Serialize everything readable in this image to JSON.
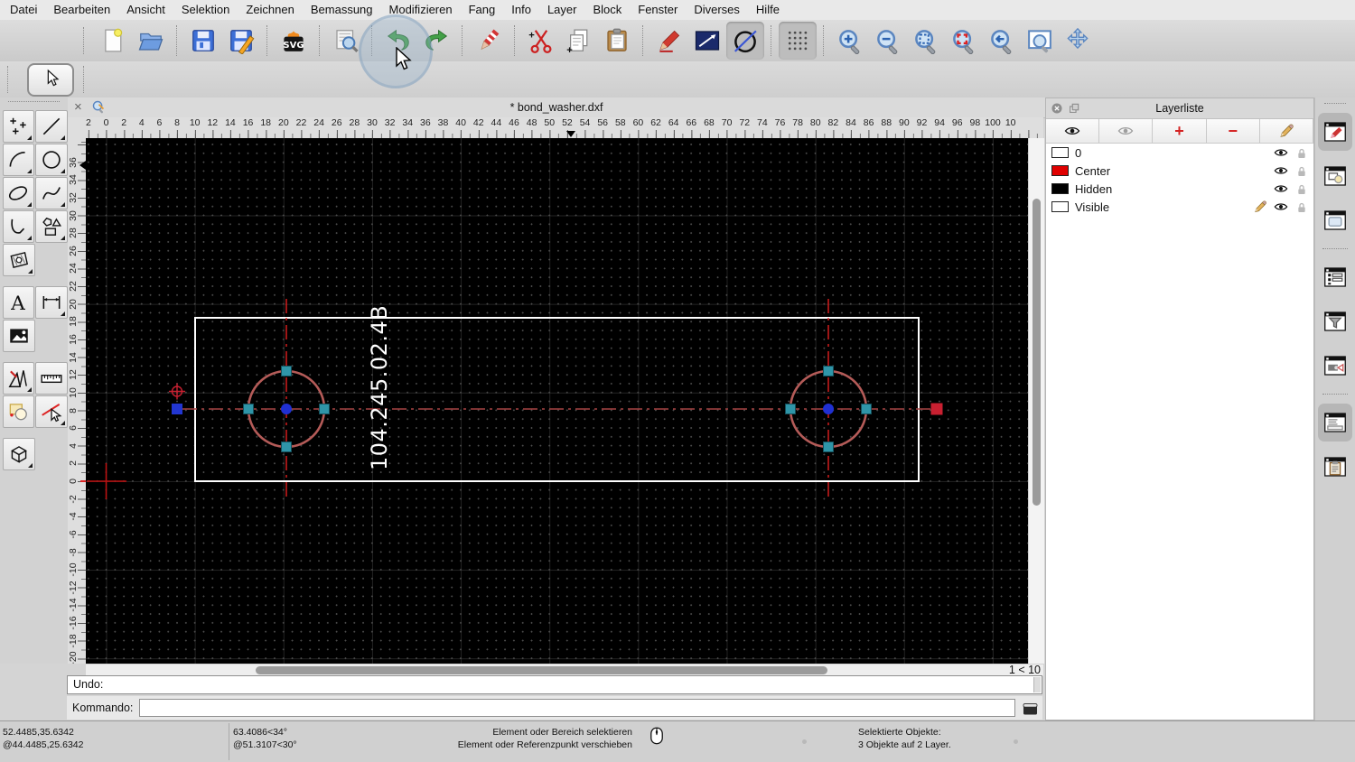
{
  "menu_bar": {
    "items": [
      "Datei",
      "Bearbeiten",
      "Ansicht",
      "Selektion",
      "Zeichnen",
      "Bemassung",
      "Modifizieren",
      "Fang",
      "Info",
      "Layer",
      "Block",
      "Fenster",
      "Diverses",
      "Hilfe"
    ]
  },
  "main_toolbar": {
    "groups": [
      [
        "file-new",
        "folder-open"
      ],
      [
        "save",
        "save-as"
      ],
      [
        "svg-export"
      ],
      [
        "print-preview"
      ],
      [
        "undo",
        "redo"
      ],
      [
        "delete-selection"
      ],
      [
        "cut",
        "copy",
        "paste"
      ],
      [
        "pen",
        "line-attributes",
        "draft-mode"
      ],
      [
        "grid-toggle"
      ],
      [
        "zoom-in",
        "zoom-out",
        "zoom-auto",
        "zoom-selected",
        "zoom-previous",
        "zoom-window",
        "zoom-pan"
      ]
    ],
    "pressed": [
      "draft-mode",
      "grid-toggle"
    ]
  },
  "select_toolbar": {
    "tool": "select-arrow"
  },
  "tool_palette": {
    "rows": [
      [
        "points",
        "line"
      ],
      [
        "arc",
        "circle"
      ],
      [
        "ellipse",
        "spline"
      ],
      [
        "polyline",
        "polygon"
      ],
      [
        "hatch"
      ],
      [
        "GAP"
      ],
      [
        "text",
        "dimension"
      ],
      [
        "image"
      ],
      [
        "GAP"
      ],
      [
        "modify",
        "measure"
      ],
      [
        "order",
        "attributes"
      ],
      [
        "GAP"
      ],
      [
        "solid"
      ]
    ],
    "with_submenu": [
      "points",
      "line",
      "arc",
      "circle",
      "ellipse",
      "spline",
      "polyline",
      "polygon",
      "hatch",
      "dimension",
      "modify",
      "attributes",
      "solid"
    ]
  },
  "document_tab": {
    "title": "* bond_washer.dxf"
  },
  "rulers": {
    "horizontal_labels": [
      "2",
      "0",
      "2",
      "4",
      "6",
      "8",
      "10",
      "12",
      "14",
      "16",
      "18",
      "20",
      "22",
      "24",
      "26",
      "28",
      "30",
      "32",
      "34",
      "36",
      "38",
      "40",
      "42",
      "44",
      "46",
      "48",
      "50",
      "52",
      "54",
      "56",
      "58",
      "60",
      "62",
      "64",
      "66",
      "68",
      "70",
      "72",
      "74",
      "76",
      "78",
      "80",
      "82",
      "84",
      "86",
      "88",
      "90",
      "92",
      "94",
      "96",
      "98",
      "100",
      "10"
    ],
    "vertical_labels": [
      "36",
      "34",
      "32",
      "30",
      "28",
      "26",
      "24",
      "22",
      "20",
      "18",
      "16",
      "14",
      "12",
      "10",
      "8",
      "6",
      "4",
      "2",
      "0",
      "-2",
      "-4",
      "-6",
      "-8",
      "-10",
      "-12",
      "-14",
      "-16",
      "-18",
      "-20"
    ]
  },
  "canvas": {
    "part_label": "104.245.02.4B",
    "colors": {
      "background": "#000000",
      "outline": "#ffffff",
      "hole_circle": "#b45b58",
      "centerline_vertical": "#e02020",
      "centerline_horizontal": "#a84444",
      "selection_handle": "#2f95a8",
      "center_node": "#2030d2",
      "endpoint_blue": "#2236d1",
      "endpoint_red": "#c92031",
      "origin_cross": "#c01010"
    }
  },
  "scrollbars": {
    "zoom_indicator": "1 < 10"
  },
  "layer_panel": {
    "title": "Layerliste",
    "toolbar": [
      "show-all-layers",
      "hide-all-layers",
      "add-layer",
      "remove-layer",
      "edit-layer"
    ],
    "layers": [
      {
        "name": "0",
        "color": "#ffffff",
        "editing": false,
        "visible": true,
        "locked": false
      },
      {
        "name": "Center",
        "color": "#e00000",
        "editing": false,
        "visible": true,
        "locked": false
      },
      {
        "name": "Hidden",
        "color": "#000000",
        "editing": false,
        "visible": true,
        "locked": false
      },
      {
        "name": "Visible",
        "color": "#ffffff",
        "editing": true,
        "visible": true,
        "locked": false
      }
    ]
  },
  "dock_strip": {
    "items": [
      "dock-pen-panel",
      "dock-block-panel",
      "dock-preview-panel",
      "dock-list-panel",
      "dock-filter-panel",
      "dock-beamer-panel",
      "dock-command-panel",
      "dock-clipboard-panel"
    ],
    "pressed": [
      "dock-pen-panel",
      "dock-command-panel"
    ]
  },
  "command_area": {
    "history_label": "Undo:",
    "prompt_label": "Kommando:",
    "input_value": ""
  },
  "status_bar": {
    "abs_coord": "52.4485,35.6342",
    "rel_coord": "@44.4485,25.6342",
    "abs_polar": "63.4086<34°",
    "rel_polar": "@51.3107<30°",
    "hint_primary": "Element oder Bereich selektieren",
    "hint_secondary": "Element oder Referenzpunkt verschieben",
    "selection_title": "Selektierte Objekte:",
    "selection_detail": "3 Objekte auf 2 Layer."
  }
}
